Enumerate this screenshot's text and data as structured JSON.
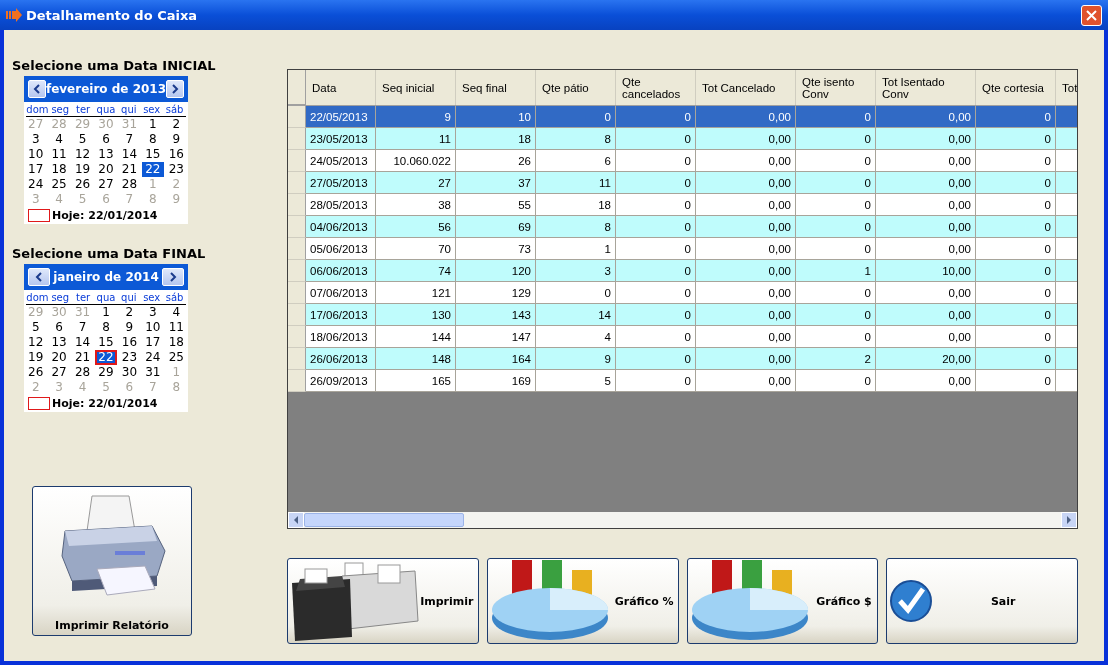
{
  "window": {
    "title": "Detalhamento do Caixa"
  },
  "calendars": [
    {
      "heading": "Selecione uma Data INICIAL",
      "month": "fevereiro de 2013",
      "weekdays": [
        "dom",
        "seg",
        "ter",
        "qua",
        "qui",
        "sex",
        "sáb"
      ],
      "days": [
        {
          "d": "27",
          "muted": true,
          "selected": false,
          "today": false
        },
        {
          "d": "28",
          "muted": true,
          "selected": false,
          "today": false
        },
        {
          "d": "29",
          "muted": true,
          "selected": false,
          "today": false
        },
        {
          "d": "30",
          "muted": true,
          "selected": false,
          "today": false
        },
        {
          "d": "31",
          "muted": true,
          "selected": false,
          "today": false
        },
        {
          "d": "1",
          "muted": false,
          "selected": false,
          "today": false
        },
        {
          "d": "2",
          "muted": false,
          "selected": false,
          "today": false
        },
        {
          "d": "3",
          "muted": false,
          "selected": false,
          "today": false
        },
        {
          "d": "4",
          "muted": false,
          "selected": false,
          "today": false
        },
        {
          "d": "5",
          "muted": false,
          "selected": false,
          "today": false
        },
        {
          "d": "6",
          "muted": false,
          "selected": false,
          "today": false
        },
        {
          "d": "7",
          "muted": false,
          "selected": false,
          "today": false
        },
        {
          "d": "8",
          "muted": false,
          "selected": false,
          "today": false
        },
        {
          "d": "9",
          "muted": false,
          "selected": false,
          "today": false
        },
        {
          "d": "10",
          "muted": false,
          "selected": false,
          "today": false
        },
        {
          "d": "11",
          "muted": false,
          "selected": false,
          "today": false
        },
        {
          "d": "12",
          "muted": false,
          "selected": false,
          "today": false
        },
        {
          "d": "13",
          "muted": false,
          "selected": false,
          "today": false
        },
        {
          "d": "14",
          "muted": false,
          "selected": false,
          "today": false
        },
        {
          "d": "15",
          "muted": false,
          "selected": false,
          "today": false
        },
        {
          "d": "16",
          "muted": false,
          "selected": false,
          "today": false
        },
        {
          "d": "17",
          "muted": false,
          "selected": false,
          "today": false
        },
        {
          "d": "18",
          "muted": false,
          "selected": false,
          "today": false
        },
        {
          "d": "19",
          "muted": false,
          "selected": false,
          "today": false
        },
        {
          "d": "20",
          "muted": false,
          "selected": false,
          "today": false
        },
        {
          "d": "21",
          "muted": false,
          "selected": false,
          "today": false
        },
        {
          "d": "22",
          "muted": false,
          "selected": true,
          "today": false
        },
        {
          "d": "23",
          "muted": false,
          "selected": false,
          "today": false
        },
        {
          "d": "24",
          "muted": false,
          "selected": false,
          "today": false
        },
        {
          "d": "25",
          "muted": false,
          "selected": false,
          "today": false
        },
        {
          "d": "26",
          "muted": false,
          "selected": false,
          "today": false
        },
        {
          "d": "27",
          "muted": false,
          "selected": false,
          "today": false
        },
        {
          "d": "28",
          "muted": false,
          "selected": false,
          "today": false
        },
        {
          "d": "1",
          "muted": true,
          "selected": false,
          "today": false
        },
        {
          "d": "2",
          "muted": true,
          "selected": false,
          "today": false
        },
        {
          "d": "3",
          "muted": true,
          "selected": false,
          "today": false
        },
        {
          "d": "4",
          "muted": true,
          "selected": false,
          "today": false
        },
        {
          "d": "5",
          "muted": true,
          "selected": false,
          "today": false
        },
        {
          "d": "6",
          "muted": true,
          "selected": false,
          "today": false
        },
        {
          "d": "7",
          "muted": true,
          "selected": false,
          "today": false
        },
        {
          "d": "8",
          "muted": true,
          "selected": false,
          "today": false
        },
        {
          "d": "9",
          "muted": true,
          "selected": false,
          "today": false
        }
      ],
      "today_label": "Hoje: 22/01/2014"
    },
    {
      "heading": "Selecione uma Data FINAL",
      "month": "janeiro de 2014",
      "weekdays": [
        "dom",
        "seg",
        "ter",
        "qua",
        "qui",
        "sex",
        "sáb"
      ],
      "days": [
        {
          "d": "29",
          "muted": true,
          "selected": false,
          "today": false
        },
        {
          "d": "30",
          "muted": true,
          "selected": false,
          "today": false
        },
        {
          "d": "31",
          "muted": true,
          "selected": false,
          "today": false
        },
        {
          "d": "1",
          "muted": false,
          "selected": false,
          "today": false
        },
        {
          "d": "2",
          "muted": false,
          "selected": false,
          "today": false
        },
        {
          "d": "3",
          "muted": false,
          "selected": false,
          "today": false
        },
        {
          "d": "4",
          "muted": false,
          "selected": false,
          "today": false
        },
        {
          "d": "5",
          "muted": false,
          "selected": false,
          "today": false
        },
        {
          "d": "6",
          "muted": false,
          "selected": false,
          "today": false
        },
        {
          "d": "7",
          "muted": false,
          "selected": false,
          "today": false
        },
        {
          "d": "8",
          "muted": false,
          "selected": false,
          "today": false
        },
        {
          "d": "9",
          "muted": false,
          "selected": false,
          "today": false
        },
        {
          "d": "10",
          "muted": false,
          "selected": false,
          "today": false
        },
        {
          "d": "11",
          "muted": false,
          "selected": false,
          "today": false
        },
        {
          "d": "12",
          "muted": false,
          "selected": false,
          "today": false
        },
        {
          "d": "13",
          "muted": false,
          "selected": false,
          "today": false
        },
        {
          "d": "14",
          "muted": false,
          "selected": false,
          "today": false
        },
        {
          "d": "15",
          "muted": false,
          "selected": false,
          "today": false
        },
        {
          "d": "16",
          "muted": false,
          "selected": false,
          "today": false
        },
        {
          "d": "17",
          "muted": false,
          "selected": false,
          "today": false
        },
        {
          "d": "18",
          "muted": false,
          "selected": false,
          "today": false
        },
        {
          "d": "19",
          "muted": false,
          "selected": false,
          "today": false
        },
        {
          "d": "20",
          "muted": false,
          "selected": false,
          "today": false
        },
        {
          "d": "21",
          "muted": false,
          "selected": false,
          "today": false
        },
        {
          "d": "22",
          "muted": false,
          "selected": true,
          "today": true
        },
        {
          "d": "23",
          "muted": false,
          "selected": false,
          "today": false
        },
        {
          "d": "24",
          "muted": false,
          "selected": false,
          "today": false
        },
        {
          "d": "25",
          "muted": false,
          "selected": false,
          "today": false
        },
        {
          "d": "26",
          "muted": false,
          "selected": false,
          "today": false
        },
        {
          "d": "27",
          "muted": false,
          "selected": false,
          "today": false
        },
        {
          "d": "28",
          "muted": false,
          "selected": false,
          "today": false
        },
        {
          "d": "29",
          "muted": false,
          "selected": false,
          "today": false
        },
        {
          "d": "30",
          "muted": false,
          "selected": false,
          "today": false
        },
        {
          "d": "31",
          "muted": false,
          "selected": false,
          "today": false
        },
        {
          "d": "1",
          "muted": true,
          "selected": false,
          "today": false
        },
        {
          "d": "2",
          "muted": true,
          "selected": false,
          "today": false
        },
        {
          "d": "3",
          "muted": true,
          "selected": false,
          "today": false
        },
        {
          "d": "4",
          "muted": true,
          "selected": false,
          "today": false
        },
        {
          "d": "5",
          "muted": true,
          "selected": false,
          "today": false
        },
        {
          "d": "6",
          "muted": true,
          "selected": false,
          "today": false
        },
        {
          "d": "7",
          "muted": true,
          "selected": false,
          "today": false
        },
        {
          "d": "8",
          "muted": true,
          "selected": false,
          "today": false
        }
      ],
      "today_label": "Hoje: 22/01/2014"
    }
  ],
  "print_report_button": "Imprimir Relatório",
  "table": {
    "columns": [
      "Data",
      "Seq inicial",
      "Seq final",
      "Qte pátio",
      "Qte cancelados",
      "Tot Cancelado",
      "Qte isento Conv",
      "Tot Isentado Conv",
      "Qte cortesia",
      "Tot"
    ],
    "rows": [
      {
        "selected": true,
        "cells": [
          "22/05/2013",
          "9",
          "10",
          "0",
          "0",
          "0,00",
          "0",
          "0,00",
          "0"
        ]
      },
      {
        "selected": false,
        "cells": [
          "23/05/2013",
          "11",
          "18",
          "8",
          "0",
          "0,00",
          "0",
          "0,00",
          "0"
        ]
      },
      {
        "selected": false,
        "cells": [
          "24/05/2013",
          "10.060.022",
          "26",
          "6",
          "0",
          "0,00",
          "0",
          "0,00",
          "0"
        ]
      },
      {
        "selected": false,
        "cells": [
          "27/05/2013",
          "27",
          "37",
          "11",
          "0",
          "0,00",
          "0",
          "0,00",
          "0"
        ]
      },
      {
        "selected": false,
        "cells": [
          "28/05/2013",
          "38",
          "55",
          "18",
          "0",
          "0,00",
          "0",
          "0,00",
          "0"
        ]
      },
      {
        "selected": false,
        "cells": [
          "04/06/2013",
          "56",
          "69",
          "8",
          "0",
          "0,00",
          "0",
          "0,00",
          "0"
        ]
      },
      {
        "selected": false,
        "cells": [
          "05/06/2013",
          "70",
          "73",
          "1",
          "0",
          "0,00",
          "0",
          "0,00",
          "0"
        ]
      },
      {
        "selected": false,
        "cells": [
          "06/06/2013",
          "74",
          "120",
          "3",
          "0",
          "0,00",
          "1",
          "10,00",
          "0"
        ]
      },
      {
        "selected": false,
        "cells": [
          "07/06/2013",
          "121",
          "129",
          "0",
          "0",
          "0,00",
          "0",
          "0,00",
          "0"
        ]
      },
      {
        "selected": false,
        "cells": [
          "17/06/2013",
          "130",
          "143",
          "14",
          "0",
          "0,00",
          "0",
          "0,00",
          "0"
        ]
      },
      {
        "selected": false,
        "cells": [
          "18/06/2013",
          "144",
          "147",
          "4",
          "0",
          "0,00",
          "0",
          "0,00",
          "0"
        ]
      },
      {
        "selected": false,
        "cells": [
          "26/06/2013",
          "148",
          "164",
          "9",
          "0",
          "0,00",
          "2",
          "20,00",
          "0"
        ]
      },
      {
        "selected": false,
        "cells": [
          "26/09/2013",
          "165",
          "169",
          "5",
          "0",
          "0,00",
          "0",
          "0,00",
          "0"
        ]
      }
    ]
  },
  "buttons": [
    {
      "label": "Imprimir",
      "kind": "printer"
    },
    {
      "label": "Gráfico %",
      "kind": "chart"
    },
    {
      "label": "Gráfico $",
      "kind": "chart"
    },
    {
      "label": "Sair",
      "kind": "exit"
    }
  ]
}
